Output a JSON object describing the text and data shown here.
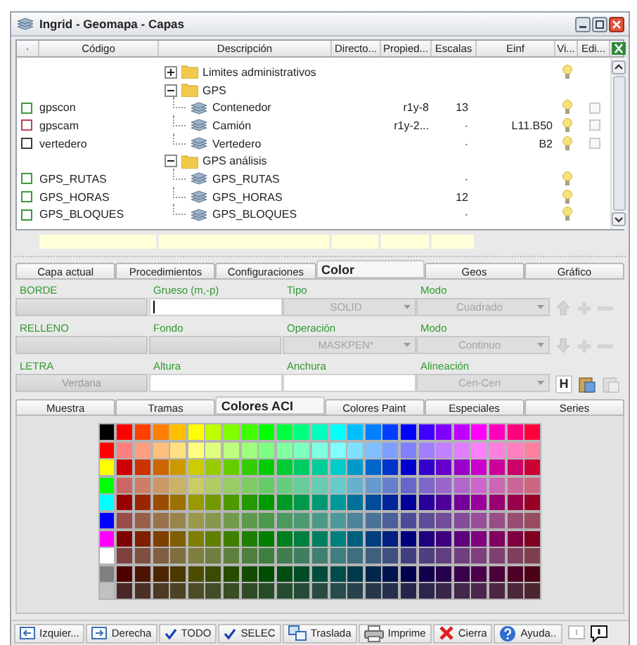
{
  "window": {
    "title": "Ingrid - Geomapa - Capas"
  },
  "table": {
    "columns": [
      {
        "label": "·"
      },
      {
        "label": "Código",
        "filter": true
      },
      {
        "label": "Descripción",
        "filter": true
      },
      {
        "label": "Directo...",
        "filter": true
      },
      {
        "label": "Propied...",
        "filter": true
      },
      {
        "label": "Escalas",
        "filter": true
      },
      {
        "label": "Einf"
      },
      {
        "label": "Vi..."
      },
      {
        "label": "Edi..."
      }
    ],
    "rows": [
      {
        "description": "Limites administrativos",
        "kind": "folder",
        "expanded": false,
        "visible": true
      },
      {
        "description": "GPS",
        "kind": "folder",
        "expanded": true,
        "children": [
          {
            "code": "gpscon",
            "color": "#3c9a3c",
            "description": "Contenedor",
            "kind": "layer",
            "owner": "r1y-8",
            "scales": "13",
            "visible": true,
            "edit": {
              "checked": false
            }
          },
          {
            "code": "gpscam",
            "color": "#c0405a",
            "description": "Camión",
            "kind": "layer",
            "owner": "r1y-2...",
            "scales": "·",
            "einf": "L11.B50",
            "visible": true,
            "edit": {
              "checked": false
            }
          },
          {
            "code": "vertedero",
            "color": "#404040",
            "description": "Vertedero",
            "kind": "layer",
            "scales": "·",
            "einf": "B2",
            "visible": true,
            "edit": {
              "checked": false
            }
          }
        ]
      },
      {
        "description": "GPS análisis",
        "kind": "folder",
        "expanded": true,
        "children": [
          {
            "code": "GPS_RUTAS",
            "color": "#3c9a3c",
            "description": "GPS_RUTAS",
            "kind": "layer",
            "scales": "·",
            "visible": true
          },
          {
            "code": "GPS_HORAS",
            "color": "#3c9a3c",
            "description": "GPS_HORAS",
            "kind": "layer",
            "scales": "12",
            "visible": true
          },
          {
            "code": "GPS_BLOQUES",
            "color": "#3c9a3c",
            "description": "GPS_BLOQUES",
            "kind": "layer",
            "scales": "·",
            "visible": true
          }
        ]
      }
    ]
  },
  "tabs": [
    {
      "label": "Capa actual",
      "selected": false
    },
    {
      "label": "Procedimientos",
      "selected": false
    },
    {
      "label": "Configuraciones",
      "selected": false
    },
    {
      "label": "Color",
      "selected": true
    },
    {
      "label": "Geos",
      "selected": false
    },
    {
      "label": "Gráfico",
      "selected": false
    }
  ],
  "form": {
    "rows": [
      {
        "fields": [
          {
            "label": "BORDE",
            "kind": "swatch"
          },
          {
            "label": "Grueso (m,-p)",
            "kind": "input",
            "focused": true
          },
          {
            "label": "Tipo",
            "kind": "select",
            "value": "SOLID",
            "disabled": true
          },
          {
            "label": "Modo",
            "kind": "select",
            "value": "Cuadrado",
            "disabled": true
          }
        ],
        "tools": [
          {
            "kind": "up",
            "disabled": true
          },
          {
            "kind": "plus",
            "disabled": true
          },
          {
            "kind": "minus",
            "disabled": true
          }
        ]
      },
      {
        "fields": [
          {
            "label": "RELLENO",
            "kind": "swatch"
          },
          {
            "label": "Fondo",
            "kind": "swatch"
          },
          {
            "label": "Operación",
            "kind": "select",
            "value": "MASKPEN*",
            "disabled": true
          },
          {
            "label": "Modo",
            "kind": "select",
            "value": "Continuo",
            "disabled": true
          }
        ],
        "tools": [
          {
            "kind": "down",
            "disabled": true
          },
          {
            "kind": "plus",
            "disabled": true
          },
          {
            "kind": "minus",
            "disabled": true
          }
        ]
      },
      {
        "fields": [
          {
            "label": "LETRA",
            "kind": "button",
            "value": "Verdana"
          },
          {
            "label": "Altura",
            "kind": "input",
            "focused": false
          },
          {
            "label": "Anchura",
            "kind": "input",
            "focused": false
          },
          {
            "label": "Alineación",
            "kind": "select",
            "value": "Cen-Cen",
            "disabled": true
          }
        ],
        "tools": [
          {
            "kind": "text",
            "label": "H",
            "disabled": false
          },
          {
            "kind": "paste",
            "disabled": false
          },
          {
            "kind": "paste",
            "disabled": true
          }
        ]
      }
    ]
  },
  "subtabs": [
    {
      "label": "Muestra",
      "selected": false
    },
    {
      "label": "Tramas",
      "selected": false
    },
    {
      "label": "Colores ACI",
      "selected": true
    },
    {
      "label": "Colores Paint",
      "selected": false
    },
    {
      "label": "Especiales",
      "selected": false
    },
    {
      "label": "Series",
      "selected": false
    }
  ],
  "palette": {
    "rows": [
      {
        "swatches": [
          {
            "color": "#000000"
          },
          {
            "color": "#ff0000"
          },
          {
            "color": "#ff3f00"
          },
          {
            "color": "#ff7f00"
          },
          {
            "color": "#ffbf00"
          },
          {
            "color": "#ffff00"
          },
          {
            "color": "#bfff00"
          },
          {
            "color": "#7fff00"
          },
          {
            "color": "#3fff00"
          },
          {
            "color": "#00ff00"
          },
          {
            "color": "#00ff3f"
          },
          {
            "color": "#00ff7f"
          },
          {
            "color": "#00ffbf"
          },
          {
            "color": "#00ffff"
          },
          {
            "color": "#00bfff"
          },
          {
            "color": "#007fff"
          },
          {
            "color": "#003fff"
          },
          {
            "color": "#0000ff"
          },
          {
            "color": "#3f00ff"
          },
          {
            "color": "#7f00ff"
          },
          {
            "color": "#bf00ff"
          },
          {
            "color": "#ff00ff"
          },
          {
            "color": "#ff00bf"
          },
          {
            "color": "#ff007f"
          },
          {
            "color": "#ff003f"
          }
        ]
      },
      {
        "swatches": [
          {
            "color": "#ff0000"
          },
          {
            "color": "#ff7f7f"
          },
          {
            "color": "#ff9f7f"
          },
          {
            "color": "#ffbf7f"
          },
          {
            "color": "#ffdf7f"
          },
          {
            "color": "#ffff7f"
          },
          {
            "color": "#dfff7f"
          },
          {
            "color": "#bfff7f"
          },
          {
            "color": "#9fff7f"
          },
          {
            "color": "#7fff7f"
          },
          {
            "color": "#7fff9f"
          },
          {
            "color": "#7fffbf"
          },
          {
            "color": "#7fffdf"
          },
          {
            "color": "#7fffff"
          },
          {
            "color": "#7fdfff"
          },
          {
            "color": "#7fbfff"
          },
          {
            "color": "#7f9fff"
          },
          {
            "color": "#7f7fff"
          },
          {
            "color": "#9f7fff"
          },
          {
            "color": "#bf7fff"
          },
          {
            "color": "#df7fff"
          },
          {
            "color": "#ff7fff"
          },
          {
            "color": "#ff7fdf"
          },
          {
            "color": "#ff7fbf"
          },
          {
            "color": "#ff7f9f"
          }
        ]
      },
      {
        "swatches": [
          {
            "color": "#ffff00"
          },
          {
            "color": "#cc0000"
          },
          {
            "color": "#cc3300"
          },
          {
            "color": "#cc6600"
          },
          {
            "color": "#cc9900"
          },
          {
            "color": "#cccc00"
          },
          {
            "color": "#99cc00"
          },
          {
            "color": "#66cc00"
          },
          {
            "color": "#33cc00"
          },
          {
            "color": "#00cc00"
          },
          {
            "color": "#00cc33"
          },
          {
            "color": "#00cc66"
          },
          {
            "color": "#00cc99"
          },
          {
            "color": "#00cccc"
          },
          {
            "color": "#0099cc"
          },
          {
            "color": "#0066cc"
          },
          {
            "color": "#0033cc"
          },
          {
            "color": "#0000cc"
          },
          {
            "color": "#3300cc"
          },
          {
            "color": "#6600cc"
          },
          {
            "color": "#9900cc"
          },
          {
            "color": "#cc00cc"
          },
          {
            "color": "#cc0099"
          },
          {
            "color": "#cc0066"
          },
          {
            "color": "#cc0033"
          }
        ]
      },
      {
        "swatches": [
          {
            "color": "#00ff00"
          },
          {
            "color": "#cc6666"
          },
          {
            "color": "#cc7f66"
          },
          {
            "color": "#cc9966"
          },
          {
            "color": "#ccb266"
          },
          {
            "color": "#cccc66"
          },
          {
            "color": "#b2cc66"
          },
          {
            "color": "#99cc66"
          },
          {
            "color": "#7fcc66"
          },
          {
            "color": "#66cc66"
          },
          {
            "color": "#66cc7f"
          },
          {
            "color": "#66cc99"
          },
          {
            "color": "#66ccb2"
          },
          {
            "color": "#66cccc"
          },
          {
            "color": "#66b2cc"
          },
          {
            "color": "#6699cc"
          },
          {
            "color": "#667fcc"
          },
          {
            "color": "#6666cc"
          },
          {
            "color": "#7f66cc"
          },
          {
            "color": "#9966cc"
          },
          {
            "color": "#b266cc"
          },
          {
            "color": "#cc66cc"
          },
          {
            "color": "#cc66b2"
          },
          {
            "color": "#cc6699"
          },
          {
            "color": "#cc667f"
          }
        ]
      },
      {
        "swatches": [
          {
            "color": "#00ffff"
          },
          {
            "color": "#990000"
          },
          {
            "color": "#992600"
          },
          {
            "color": "#994c00"
          },
          {
            "color": "#997200"
          },
          {
            "color": "#999900"
          },
          {
            "color": "#729900"
          },
          {
            "color": "#4c9900"
          },
          {
            "color": "#269900"
          },
          {
            "color": "#009900"
          },
          {
            "color": "#009926"
          },
          {
            "color": "#00994c"
          },
          {
            "color": "#009972"
          },
          {
            "color": "#009999"
          },
          {
            "color": "#007299"
          },
          {
            "color": "#004c99"
          },
          {
            "color": "#002699"
          },
          {
            "color": "#000099"
          },
          {
            "color": "#260099"
          },
          {
            "color": "#4c0099"
          },
          {
            "color": "#720099"
          },
          {
            "color": "#990099"
          },
          {
            "color": "#990072"
          },
          {
            "color": "#99004c"
          },
          {
            "color": "#990026"
          }
        ]
      },
      {
        "swatches": [
          {
            "color": "#0000ff"
          },
          {
            "color": "#994c4c"
          },
          {
            "color": "#995f4c"
          },
          {
            "color": "#99724c"
          },
          {
            "color": "#99854c"
          },
          {
            "color": "#99994c"
          },
          {
            "color": "#85994c"
          },
          {
            "color": "#72994c"
          },
          {
            "color": "#5f994c"
          },
          {
            "color": "#4c994c"
          },
          {
            "color": "#4c995f"
          },
          {
            "color": "#4c9972"
          },
          {
            "color": "#4c9985"
          },
          {
            "color": "#4c9999"
          },
          {
            "color": "#4c8599"
          },
          {
            "color": "#4c7299"
          },
          {
            "color": "#4c5f99"
          },
          {
            "color": "#4c4c99"
          },
          {
            "color": "#5f4c99"
          },
          {
            "color": "#724c99"
          },
          {
            "color": "#854c99"
          },
          {
            "color": "#994c99"
          },
          {
            "color": "#994c85"
          },
          {
            "color": "#994c72"
          },
          {
            "color": "#994c5f"
          }
        ]
      },
      {
        "swatches": [
          {
            "color": "#ff00ff"
          },
          {
            "color": "#7f0000"
          },
          {
            "color": "#7f1f00"
          },
          {
            "color": "#7f3f00"
          },
          {
            "color": "#7f5f00"
          },
          {
            "color": "#7f7f00"
          },
          {
            "color": "#5f7f00"
          },
          {
            "color": "#3f7f00"
          },
          {
            "color": "#1f7f00"
          },
          {
            "color": "#007f00"
          },
          {
            "color": "#007f1f"
          },
          {
            "color": "#007f3f"
          },
          {
            "color": "#007f5f"
          },
          {
            "color": "#007f7f"
          },
          {
            "color": "#005f7f"
          },
          {
            "color": "#003f7f"
          },
          {
            "color": "#001f7f"
          },
          {
            "color": "#00007f"
          },
          {
            "color": "#1f007f"
          },
          {
            "color": "#3f007f"
          },
          {
            "color": "#5f007f"
          },
          {
            "color": "#7f007f"
          },
          {
            "color": "#7f005f"
          },
          {
            "color": "#7f003f"
          },
          {
            "color": "#7f001f"
          }
        ]
      },
      {
        "swatches": [
          {
            "color": "#ffffff"
          },
          {
            "color": "#7f3f3f"
          },
          {
            "color": "#7f4f3f"
          },
          {
            "color": "#7f5f3f"
          },
          {
            "color": "#7f6f3f"
          },
          {
            "color": "#7f7f3f"
          },
          {
            "color": "#6f7f3f"
          },
          {
            "color": "#5f7f3f"
          },
          {
            "color": "#4f7f3f"
          },
          {
            "color": "#3f7f3f"
          },
          {
            "color": "#3f7f4f"
          },
          {
            "color": "#3f7f5f"
          },
          {
            "color": "#3f7f6f"
          },
          {
            "color": "#3f7f7f"
          },
          {
            "color": "#3f6f7f"
          },
          {
            "color": "#3f5f7f"
          },
          {
            "color": "#3f4f7f"
          },
          {
            "color": "#3f3f7f"
          },
          {
            "color": "#4f3f7f"
          },
          {
            "color": "#5f3f7f"
          },
          {
            "color": "#6f3f7f"
          },
          {
            "color": "#7f3f7f"
          },
          {
            "color": "#7f3f6f"
          },
          {
            "color": "#7f3f5f"
          },
          {
            "color": "#7f3f4f"
          }
        ]
      },
      {
        "swatches": [
          {
            "color": "#808080"
          },
          {
            "color": "#4c0000"
          },
          {
            "color": "#4c1300"
          },
          {
            "color": "#4c2600"
          },
          {
            "color": "#4c3900"
          },
          {
            "color": "#4c4c00"
          },
          {
            "color": "#394c00"
          },
          {
            "color": "#264c00"
          },
          {
            "color": "#134c00"
          },
          {
            "color": "#004c00"
          },
          {
            "color": "#004c13"
          },
          {
            "color": "#004c26"
          },
          {
            "color": "#004c39"
          },
          {
            "color": "#004c4c"
          },
          {
            "color": "#00394c"
          },
          {
            "color": "#00264c"
          },
          {
            "color": "#00134c"
          },
          {
            "color": "#00004c"
          },
          {
            "color": "#13004c"
          },
          {
            "color": "#26004c"
          },
          {
            "color": "#39004c"
          },
          {
            "color": "#4c004c"
          },
          {
            "color": "#4c0039"
          },
          {
            "color": "#4c0026"
          },
          {
            "color": "#4c0013"
          }
        ]
      },
      {
        "swatches": [
          {
            "color": "#c0c0c0"
          },
          {
            "color": "#4c2626"
          },
          {
            "color": "#4c2f26"
          },
          {
            "color": "#4c3926"
          },
          {
            "color": "#4c4226"
          },
          {
            "color": "#4c4c26"
          },
          {
            "color": "#424c26"
          },
          {
            "color": "#394c26"
          },
          {
            "color": "#2f4c26"
          },
          {
            "color": "#264c26"
          },
          {
            "color": "#264c2f"
          },
          {
            "color": "#264c39"
          },
          {
            "color": "#264c42"
          },
          {
            "color": "#264c4c"
          },
          {
            "color": "#26424c"
          },
          {
            "color": "#26394c"
          },
          {
            "color": "#262f4c"
          },
          {
            "color": "#26264c"
          },
          {
            "color": "#2f264c"
          },
          {
            "color": "#39264c"
          },
          {
            "color": "#42264c"
          },
          {
            "color": "#4c264c"
          },
          {
            "color": "#4c2642"
          },
          {
            "color": "#4c2639"
          },
          {
            "color": "#4c262f"
          }
        ]
      }
    ]
  },
  "toolbar": [
    {
      "label": "Izquier...",
      "kind": "move-left"
    },
    {
      "label": "Derecha",
      "kind": "move-right"
    },
    {
      "label": "TODO",
      "kind": "check"
    },
    {
      "label": "SELEC",
      "kind": "check"
    },
    {
      "label": "Traslada",
      "kind": "layers"
    },
    {
      "label": "Imprime",
      "kind": "print"
    },
    {
      "label": "Cierra",
      "kind": "close"
    },
    {
      "label": "Ayuda..",
      "kind": "help"
    },
    {
      "kind": "info",
      "disabled": true
    },
    {
      "kind": "comment",
      "disabled": false
    }
  ]
}
